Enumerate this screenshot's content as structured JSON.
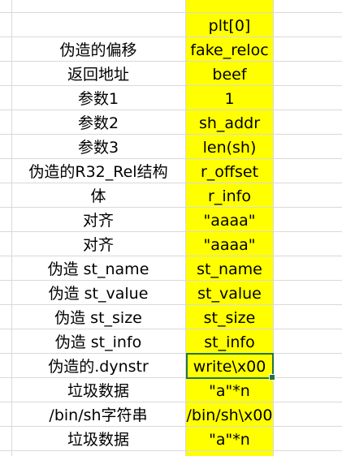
{
  "sheet": {
    "rows": [
      {
        "a": "",
        "b": "plt[0]"
      },
      {
        "a": "伪造的偏移",
        "b": "fake_reloc"
      },
      {
        "a": "返回地址",
        "b": "beef"
      },
      {
        "a": "参数1",
        "b": "1"
      },
      {
        "a": "参数2",
        "b": "sh_addr"
      },
      {
        "a": "参数3",
        "b": "len(sh)"
      },
      {
        "a": "伪造的R32_Rel结构",
        "b": "r_offset"
      },
      {
        "a": "体",
        "b": "r_info"
      },
      {
        "a": "对齐",
        "b": "\"aaaa\""
      },
      {
        "a": "对齐",
        "b": "\"aaaa\""
      },
      {
        "a": "伪造 st_name",
        "b": "st_name"
      },
      {
        "a": "伪造 st_value",
        "b": "st_value"
      },
      {
        "a": "伪造 st_size",
        "b": "st_size"
      },
      {
        "a": "伪造 st_info",
        "b": "st_info"
      },
      {
        "a": "伪造的.dynstr",
        "b": "write\\x00"
      },
      {
        "a": "垃圾数据",
        "b": "\"a\"*n"
      },
      {
        "a": "/bin/sh字符串",
        "b": "/bin/sh\\x00"
      },
      {
        "a": "垃圾数据",
        "b": "\"a\"*n"
      }
    ],
    "selected_row_index": 14,
    "highlight_color": "#ffff00",
    "selection_color": "#217346",
    "gridline_color": "#d9d9d9"
  }
}
